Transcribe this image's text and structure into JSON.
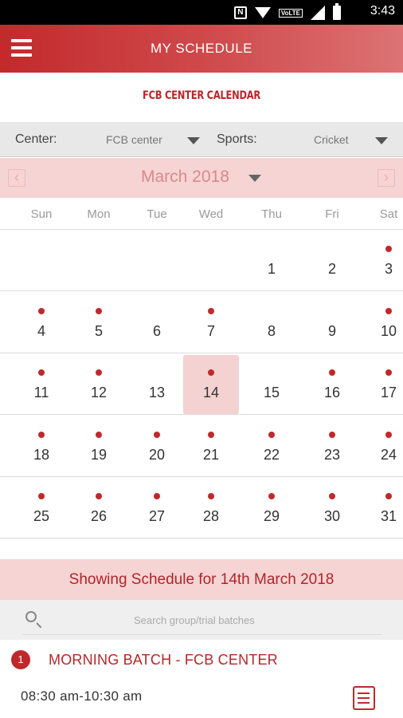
{
  "status_bar": {
    "time": "3:43",
    "nfc_glyph": "N"
  },
  "app_bar": {
    "title": "MY SCHEDULE"
  },
  "calendar_heading": "FCB CENTER CALENDAR",
  "filters": {
    "center_label": "Center:",
    "center_value": "FCB center",
    "sports_label": "Sports:",
    "sports_value": "Cricket"
  },
  "month": {
    "title": "March 2018",
    "prev_glyph": "‹",
    "next_glyph": "›"
  },
  "weekdays": [
    "Sun",
    "Mon",
    "Tue",
    "Wed",
    "Thu",
    "Fri",
    "Sat"
  ],
  "weeks": [
    [
      null,
      null,
      null,
      null,
      {
        "d": "1",
        "dot": false
      },
      {
        "d": "2",
        "dot": false
      },
      {
        "d": "3",
        "dot": true
      }
    ],
    [
      {
        "d": "4",
        "dot": true
      },
      {
        "d": "5",
        "dot": true
      },
      {
        "d": "6",
        "dot": false
      },
      {
        "d": "7",
        "dot": true
      },
      {
        "d": "8",
        "dot": false
      },
      {
        "d": "9",
        "dot": false
      },
      {
        "d": "10",
        "dot": true
      }
    ],
    [
      {
        "d": "11",
        "dot": true
      },
      {
        "d": "12",
        "dot": true
      },
      {
        "d": "13",
        "dot": false
      },
      {
        "d": "14",
        "dot": true,
        "selected": true
      },
      {
        "d": "15",
        "dot": false
      },
      {
        "d": "16",
        "dot": true
      },
      {
        "d": "17",
        "dot": true
      }
    ],
    [
      {
        "d": "18",
        "dot": true
      },
      {
        "d": "19",
        "dot": true
      },
      {
        "d": "20",
        "dot": true
      },
      {
        "d": "21",
        "dot": true
      },
      {
        "d": "22",
        "dot": true
      },
      {
        "d": "23",
        "dot": true
      },
      {
        "d": "24",
        "dot": true
      }
    ],
    [
      {
        "d": "25",
        "dot": true
      },
      {
        "d": "26",
        "dot": true
      },
      {
        "d": "27",
        "dot": true
      },
      {
        "d": "28",
        "dot": true
      },
      {
        "d": "29",
        "dot": true
      },
      {
        "d": "30",
        "dot": true
      },
      {
        "d": "31",
        "dot": true
      }
    ]
  ],
  "schedule_banner": "Showing Schedule for 14th March 2018",
  "search": {
    "placeholder": "Search group/trial batches"
  },
  "batches": [
    {
      "index": "1",
      "name": "MORNING BATCH - FCB CENTER",
      "time": "08:30 am-10:30 am"
    }
  ],
  "colors": {
    "accent": "#c0292b",
    "light_accent": "#f6d4d4"
  },
  "icons": [
    "nfc-icon",
    "wifi-icon",
    "volte-icon",
    "signal-icon",
    "battery-icon",
    "menu-icon",
    "chevron-left-icon",
    "chevron-right-icon",
    "caret-down-icon",
    "search-icon",
    "list-icon"
  ]
}
